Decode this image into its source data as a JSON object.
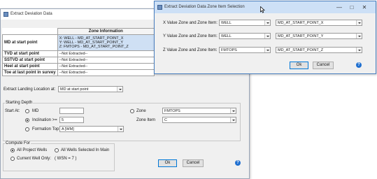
{
  "main_dialog": {
    "title": "Extract Deviation Data",
    "grid": {
      "header": "Zone Information",
      "rows": [
        {
          "label": "MD at start point",
          "values": [
            "X: WELL - MD_AT_START_POINT_X",
            "Y: WELL - MD_AT_START_POINT_Y",
            "Z: FMTOPS - MD_AT_START_POINT_Z"
          ]
        },
        {
          "label": "TVD at start point",
          "values": [
            "--Not Extracted--"
          ]
        },
        {
          "label": "SSTVD at start point",
          "values": [
            "--Not Extracted--"
          ]
        },
        {
          "label": "Heel at start point",
          "values": [
            "--Not Extracted--"
          ]
        },
        {
          "label": "Toe at last point in survey",
          "values": [
            "--Not Extracted--"
          ]
        }
      ]
    },
    "landing": {
      "label": "Extract Landing Location at:",
      "value": "MD at start point"
    },
    "starting_depth": {
      "group_title": "Starting Depth",
      "start_at_label": "Start At:",
      "md_label": "MD",
      "md_value": "",
      "inclination_label": "Inclination >=",
      "inclination_value": "5",
      "formation_top_label": "Formation Top",
      "formation_top_value": "A  [WM]",
      "zone_label": "Zone",
      "zone_value": "FMTOPS",
      "zone_item_label": "Zone Item",
      "zone_item_value": "C"
    },
    "compute_for": {
      "group_title": "Compute For",
      "all_project_wells": "All Project Wells",
      "all_wells_selected": "All Wells Selected In Main",
      "current_well_only": "Current Well Only:",
      "wsn": "( WSN = 7 )"
    },
    "ok_label": "Ok",
    "cancel_label": "Cancel",
    "help": "?"
  },
  "zone_dialog": {
    "title": "Extract Deviation Data Zone Item Selection",
    "rows": [
      {
        "label": "X Value Zone and Zone Item:",
        "zone": "WELL",
        "item": "MD_AT_START_POINT_X"
      },
      {
        "label": "Y Value Zone and Zone Item:",
        "zone": "WELL",
        "item": "MD_AT_START_POINT_Y"
      },
      {
        "label": "Z Value Zone and Zone Item:",
        "zone": "FMTOPS",
        "item": "MD_AT_START_POINT_Z"
      }
    ],
    "ok_label": "Ok",
    "cancel_label": "Cancel",
    "help": "?"
  },
  "icons": [
    "app-icon",
    "minimize-icon",
    "maximize-icon",
    "close-icon",
    "dropdown-arrow-icon",
    "help-icon",
    "mouse-cursor-icon"
  ],
  "colors": {
    "title_active": "#cde0f6",
    "selection": "#cfe0f4",
    "help": "#1f6fd0",
    "border": "#9aa6b8"
  }
}
